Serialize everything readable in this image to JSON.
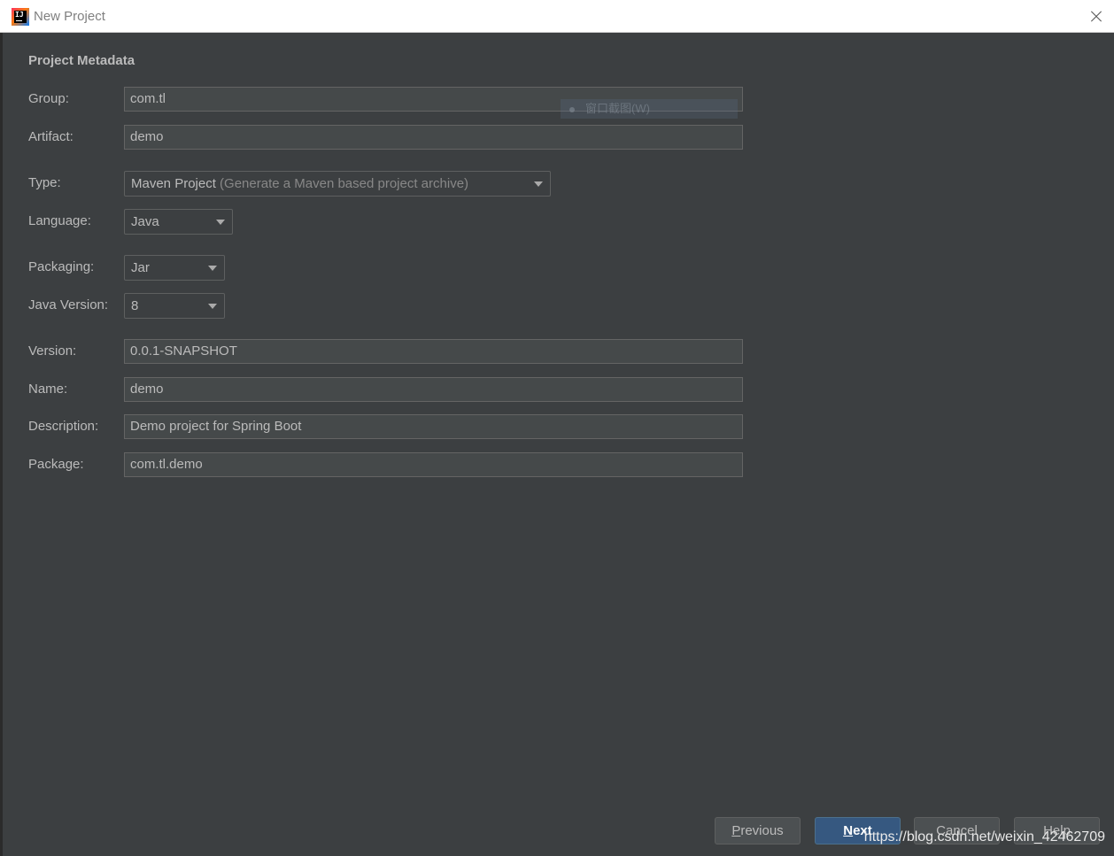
{
  "window": {
    "title": "New Project",
    "app_icon_text": "IJ"
  },
  "section": {
    "title": "Project Metadata"
  },
  "fields": {
    "group": {
      "label": "Group:",
      "value": "com.tl"
    },
    "artifact": {
      "label": "Artifact:",
      "value": "demo"
    },
    "type": {
      "label": "Type:",
      "value": "Maven Project",
      "hint": "(Generate a Maven based project archive)"
    },
    "language": {
      "label": "Language:",
      "value": "Java"
    },
    "packaging": {
      "label": "Packaging:",
      "value": "Jar"
    },
    "java_version": {
      "label": "Java Version:",
      "value": "8"
    },
    "version": {
      "label": "Version:",
      "value": "0.0.1-SNAPSHOT"
    },
    "name": {
      "label": "Name:",
      "value": "demo"
    },
    "description": {
      "label": "Description:",
      "value": "Demo project for Spring Boot"
    },
    "package": {
      "label": "Package:",
      "value": "com.tl.demo"
    }
  },
  "overlay": {
    "text": "窗口截图(W)"
  },
  "buttons": {
    "previous": {
      "mnemonic": "P",
      "rest": "revious"
    },
    "next": {
      "mnemonic": "N",
      "rest": "ext"
    },
    "cancel": {
      "label": "Cancel"
    },
    "help": {
      "label": "Help"
    }
  },
  "watermark": "https://blog.csdn.net/weixin_42462709",
  "colors": {
    "background": "#3c3f41",
    "field_bg": "#45494a",
    "text": "#bbbbbb",
    "primary_button": "#365880"
  }
}
